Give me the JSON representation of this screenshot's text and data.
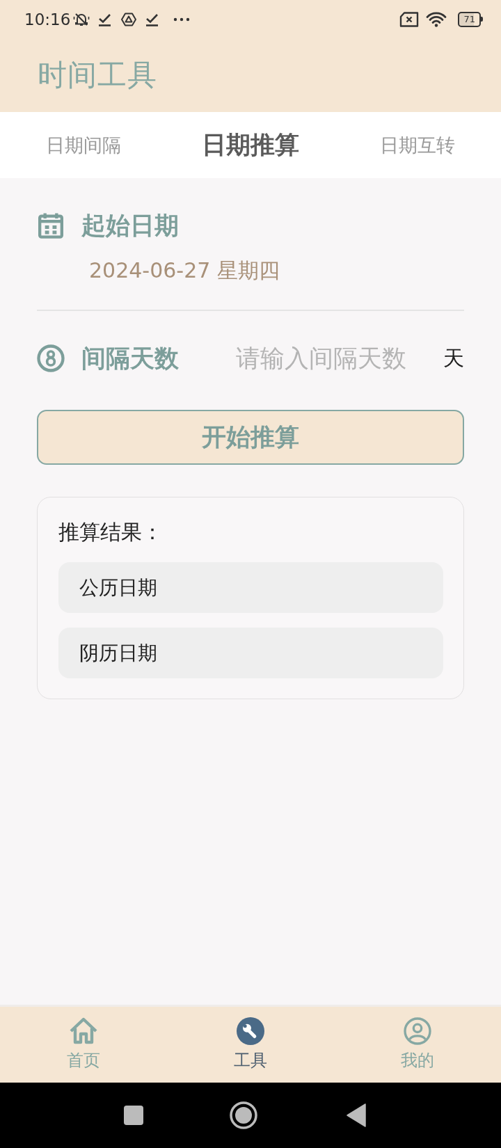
{
  "status_bar": {
    "time": "10:16",
    "battery": "71"
  },
  "header": {
    "title": "时间工具"
  },
  "tabs": [
    {
      "label": "日期间隔",
      "selected": false
    },
    {
      "label": "日期推算",
      "selected": true
    },
    {
      "label": "日期互转",
      "selected": false
    }
  ],
  "form": {
    "start_date": {
      "label": "起始日期",
      "value": "2024-06-27 星期四"
    },
    "interval": {
      "label": "间隔天数",
      "placeholder": "请输入间隔天数",
      "unit": "天"
    },
    "submit": "开始推算"
  },
  "result": {
    "title": "推算结果：",
    "items": [
      {
        "label": "公历日期"
      },
      {
        "label": "阴历日期"
      }
    ]
  },
  "bottom_nav": [
    {
      "label": "首页",
      "kind": "home",
      "selected": false
    },
    {
      "label": "工具",
      "kind": "tools",
      "selected": true
    },
    {
      "label": "我的",
      "kind": "profile",
      "selected": false
    }
  ]
}
